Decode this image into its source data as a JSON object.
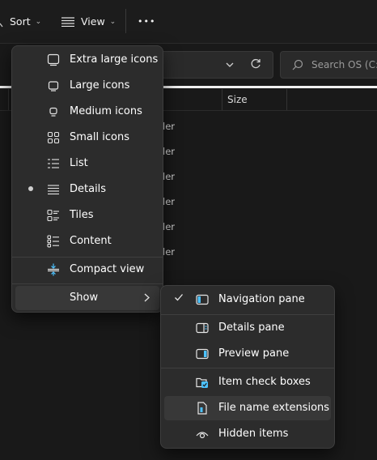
{
  "toolbar": {
    "sort_label": "Sort",
    "view_label": "View",
    "more_label": "•••"
  },
  "search": {
    "placeholder": "Search OS (C:)"
  },
  "columns": {
    "size_label": "Size"
  },
  "rows": [
    "ler",
    "ler",
    "ler",
    "ler",
    "ler",
    "ler"
  ],
  "view_menu": {
    "items": [
      {
        "label": "Extra large icons",
        "icon": "extra-large-icons-icon"
      },
      {
        "label": "Large icons",
        "icon": "large-icons-icon"
      },
      {
        "label": "Medium icons",
        "icon": "medium-icons-icon"
      },
      {
        "label": "Small icons",
        "icon": "small-icons-icon"
      },
      {
        "label": "List",
        "icon": "list-icon"
      },
      {
        "label": "Details",
        "icon": "details-icon",
        "selected": true
      },
      {
        "label": "Tiles",
        "icon": "tiles-icon"
      },
      {
        "label": "Content",
        "icon": "content-icon"
      },
      {
        "label": "Compact view",
        "icon": "compact-view-icon"
      },
      {
        "label": "Show",
        "icon": "chevron-right-icon",
        "has_submenu": true
      }
    ]
  },
  "show_menu": {
    "items": [
      {
        "label": "Navigation pane",
        "icon": "navigation-pane-icon",
        "checked": true
      },
      {
        "label": "Details pane",
        "icon": "details-pane-icon"
      },
      {
        "label": "Preview pane",
        "icon": "preview-pane-icon"
      },
      {
        "label": "Item check boxes",
        "icon": "item-check-boxes-icon"
      },
      {
        "label": "File name extensions",
        "icon": "file-name-extensions-icon",
        "hovered": true
      },
      {
        "label": "Hidden items",
        "icon": "hidden-items-icon"
      }
    ]
  },
  "colors": {
    "accent": "#4cc2ff",
    "menu_bg": "#2c2c2c",
    "window_bg": "#191919"
  }
}
